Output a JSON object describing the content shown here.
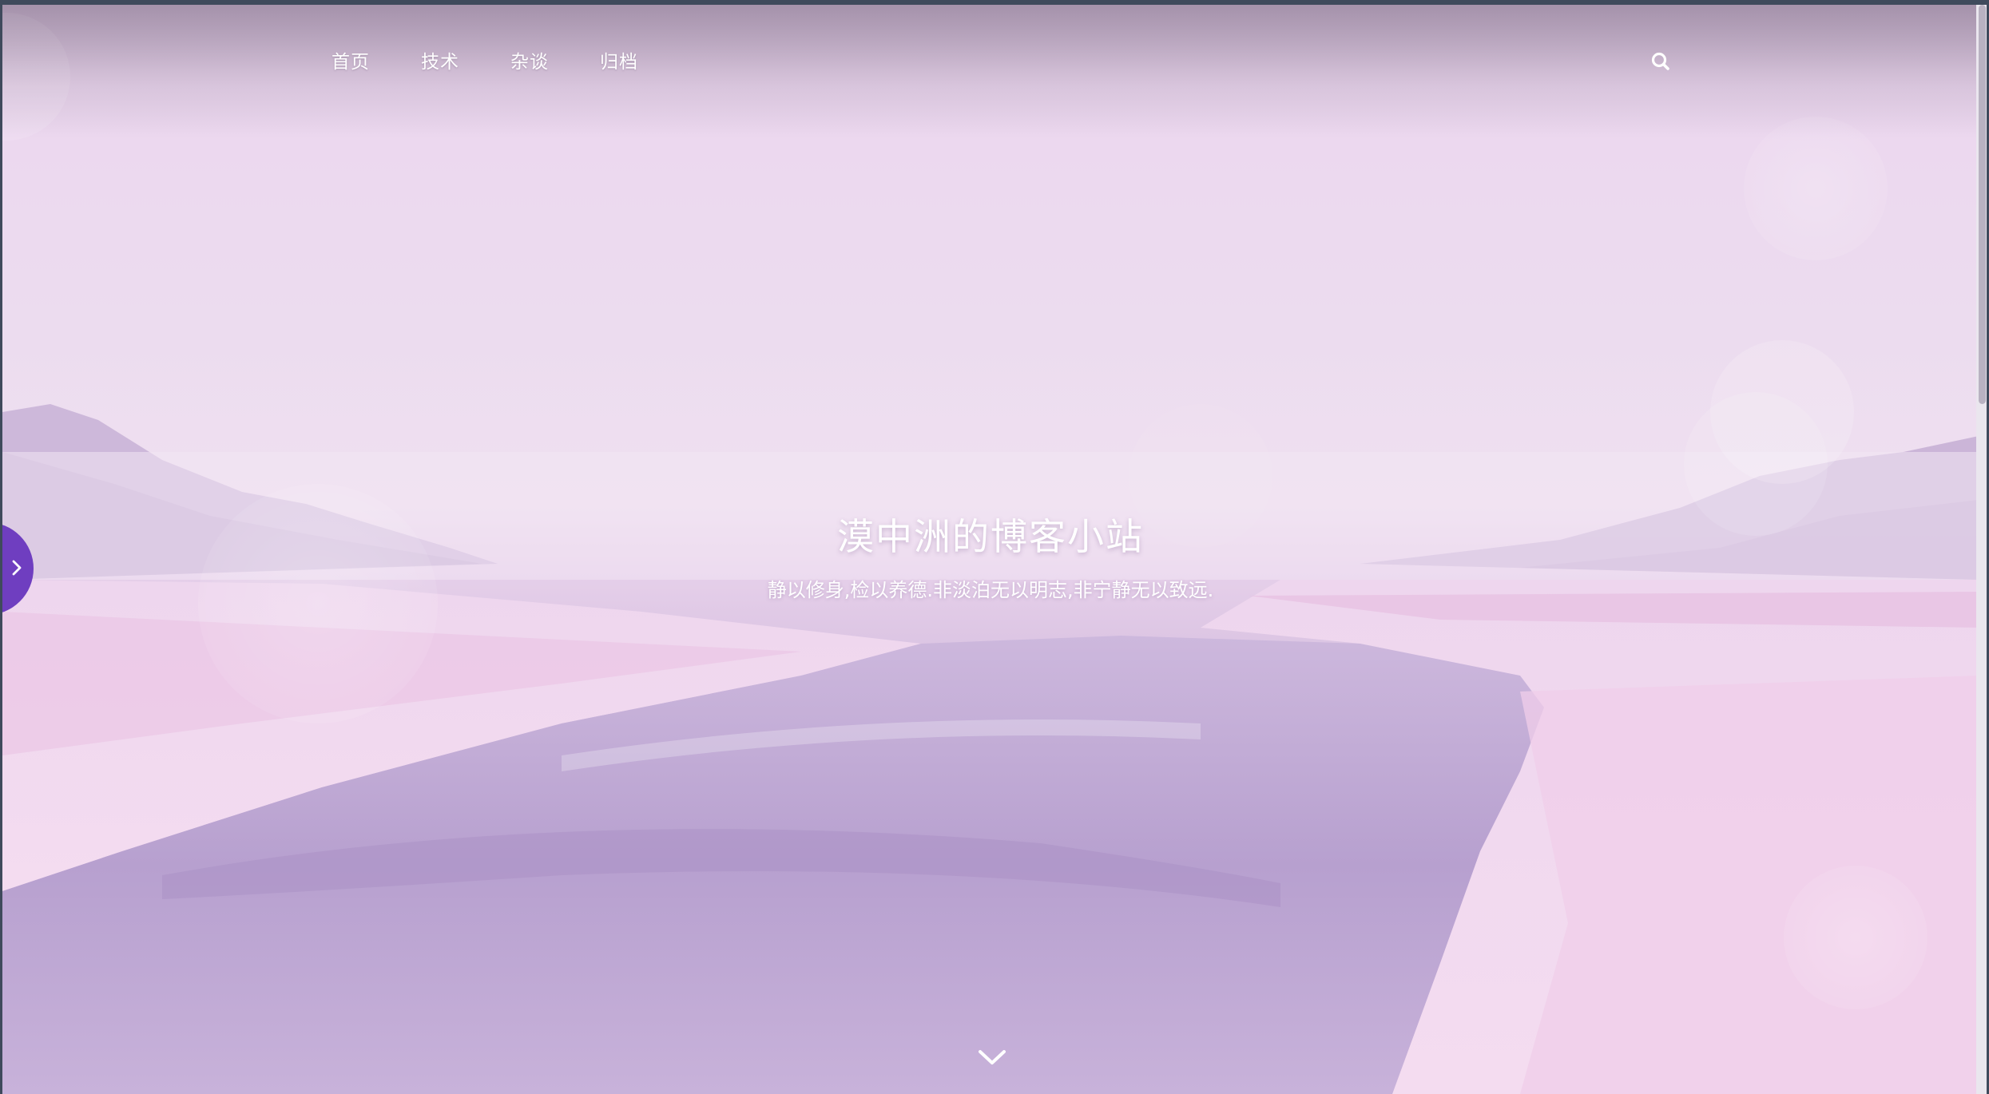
{
  "nav": {
    "items": [
      {
        "label": "首页"
      },
      {
        "label": "技术"
      },
      {
        "label": "杂谈"
      },
      {
        "label": "归档"
      }
    ],
    "search_icon": "search-icon"
  },
  "hero": {
    "title": "漠中洲的博客小站",
    "subtitle": "静以修身,检以养德.非淡泊无以明志,非宁静无以致远.",
    "scroll_icon": "chevron-down-icon"
  },
  "sidebar_toggle": {
    "icon": "chevron-right-icon",
    "color": "#6f3ec0"
  },
  "colors": {
    "accent": "#6f3ec0",
    "text": "#ffffff"
  }
}
